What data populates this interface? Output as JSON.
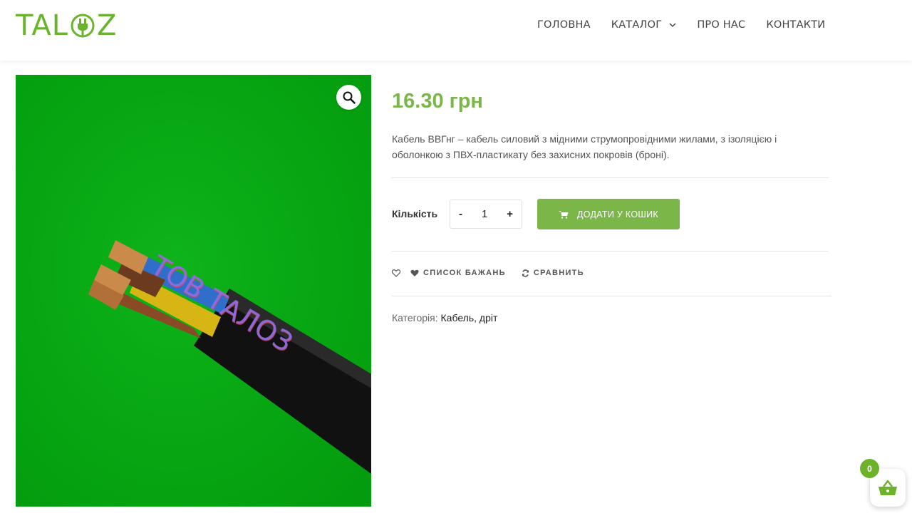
{
  "header": {
    "logo_text_left": "TAL",
    "logo_text_right": "Z",
    "nav": [
      {
        "label": "ГОЛОВНА"
      },
      {
        "label": "КАТАЛОГ"
      },
      {
        "label": "ПРО НАС"
      },
      {
        "label": "КОНТАКТИ"
      }
    ]
  },
  "product": {
    "image_watermark": "ТОВ ТАЛОЗ",
    "price": "16.30 грн",
    "description": "Кабель ВВГнг – кабель силовий з мідними струмопровідними жилами, з ізоляцією і оболонкою з ПВХ-пластикату без захисних покровів (броні).",
    "quantity_label": "Кількість",
    "quantity_minus": "-",
    "quantity_value": "1",
    "quantity_plus": "+",
    "add_to_cart": "ДОДАТИ У КОШИК",
    "wishlist": "СПИСОК БАЖАНЬ",
    "compare": "СРАВНИТЬ",
    "category_label": "Категорія:",
    "category_value": "Кабель, дріт"
  },
  "minicart": {
    "count": "0"
  },
  "colors": {
    "accent": "#7ab648",
    "logo": "#6ab42d",
    "image_bg": "#06a612"
  }
}
